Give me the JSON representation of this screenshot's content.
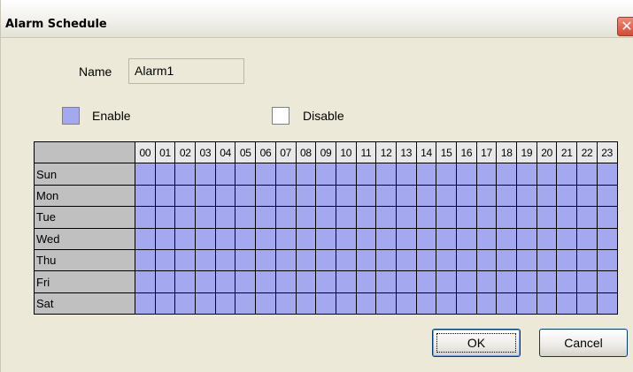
{
  "window": {
    "title": "Alarm Schedule",
    "close_glyph": "✕"
  },
  "form": {
    "name_label": "Name",
    "name_value": "Alarm1"
  },
  "legend": {
    "enable_label": "Enable",
    "disable_label": "Disable"
  },
  "schedule": {
    "hours": [
      "00",
      "01",
      "02",
      "03",
      "04",
      "05",
      "06",
      "07",
      "08",
      "09",
      "10",
      "11",
      "12",
      "13",
      "14",
      "15",
      "16",
      "17",
      "18",
      "19",
      "20",
      "21",
      "22",
      "23"
    ],
    "days": [
      "Sun",
      "Mon",
      "Tue",
      "Wed",
      "Thu",
      "Fri",
      "Sat"
    ],
    "enabled": [
      [
        1,
        1,
        1,
        1,
        1,
        1,
        1,
        1,
        1,
        1,
        1,
        1,
        1,
        1,
        1,
        1,
        1,
        1,
        1,
        1,
        1,
        1,
        1,
        1
      ],
      [
        1,
        1,
        1,
        1,
        1,
        1,
        1,
        1,
        1,
        1,
        1,
        1,
        1,
        1,
        1,
        1,
        1,
        1,
        1,
        1,
        1,
        1,
        1,
        1
      ],
      [
        1,
        1,
        1,
        1,
        1,
        1,
        1,
        1,
        1,
        1,
        1,
        1,
        1,
        1,
        1,
        1,
        1,
        1,
        1,
        1,
        1,
        1,
        1,
        1
      ],
      [
        1,
        1,
        1,
        1,
        1,
        1,
        1,
        1,
        1,
        1,
        1,
        1,
        1,
        1,
        1,
        1,
        1,
        1,
        1,
        1,
        1,
        1,
        1,
        1
      ],
      [
        1,
        1,
        1,
        1,
        1,
        1,
        1,
        1,
        1,
        1,
        1,
        1,
        1,
        1,
        1,
        1,
        1,
        1,
        1,
        1,
        1,
        1,
        1,
        1
      ],
      [
        1,
        1,
        1,
        1,
        1,
        1,
        1,
        1,
        1,
        1,
        1,
        1,
        1,
        1,
        1,
        1,
        1,
        1,
        1,
        1,
        1,
        1,
        1,
        1
      ],
      [
        1,
        1,
        1,
        1,
        1,
        1,
        1,
        1,
        1,
        1,
        1,
        1,
        1,
        1,
        1,
        1,
        1,
        1,
        1,
        1,
        1,
        1,
        1,
        1
      ]
    ]
  },
  "buttons": {
    "ok_label": "OK",
    "cancel_label": "Cancel"
  },
  "colors": {
    "enabled": "#a4a9ef",
    "disabled": "#ffffff",
    "dialog_bg": "#ece9d8"
  }
}
